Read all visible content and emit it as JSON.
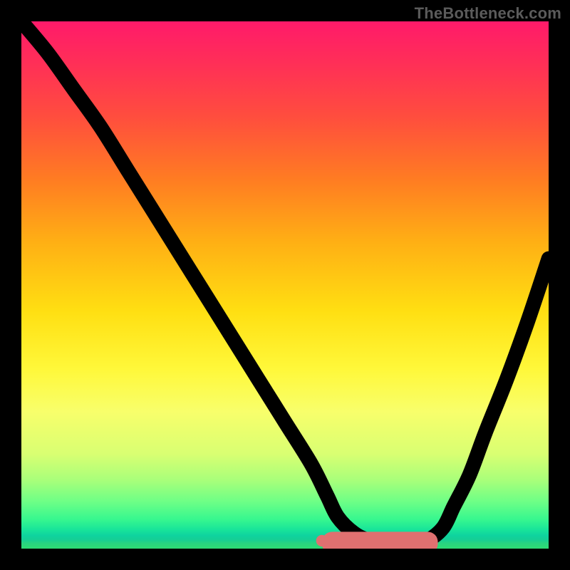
{
  "watermark": "TheBottleneck.com",
  "chart_data": {
    "type": "line",
    "title": "",
    "xlabel": "",
    "ylabel": "",
    "xlim": [
      0,
      100
    ],
    "ylim": [
      0,
      100
    ],
    "grid": false,
    "legend": false,
    "series": [
      {
        "name": "bottleneck-curve",
        "x": [
          0,
          5,
          10,
          15,
          20,
          25,
          30,
          35,
          40,
          45,
          50,
          55,
          58,
          60,
          63,
          66,
          70,
          74,
          77,
          80,
          82,
          85,
          88,
          92,
          96,
          100
        ],
        "y": [
          100,
          94,
          87,
          80,
          72,
          64,
          56,
          48,
          40,
          32,
          24,
          16,
          10,
          6,
          3,
          1.5,
          0.5,
          0.5,
          1.5,
          4,
          8,
          14,
          22,
          32,
          43,
          55
        ]
      }
    ],
    "annotations": [
      {
        "name": "flat-bottom-overlap",
        "x_range": [
          58,
          78
        ],
        "y": 0,
        "color": "#e07070",
        "note": "rose-colored flattened trough segment"
      },
      {
        "name": "marker-dot",
        "x": 57,
        "y": 1.5,
        "color": "#e07070"
      }
    ],
    "background_gradient": {
      "direction": "vertical",
      "stops": [
        {
          "pos": 0.0,
          "color": "#ff1a6a"
        },
        {
          "pos": 0.18,
          "color": "#ff4d3e"
        },
        {
          "pos": 0.42,
          "color": "#ffb014"
        },
        {
          "pos": 0.66,
          "color": "#fff83a"
        },
        {
          "pos": 0.91,
          "color": "#6fff86"
        },
        {
          "pos": 1.0,
          "color": "#2edb73"
        }
      ]
    }
  }
}
